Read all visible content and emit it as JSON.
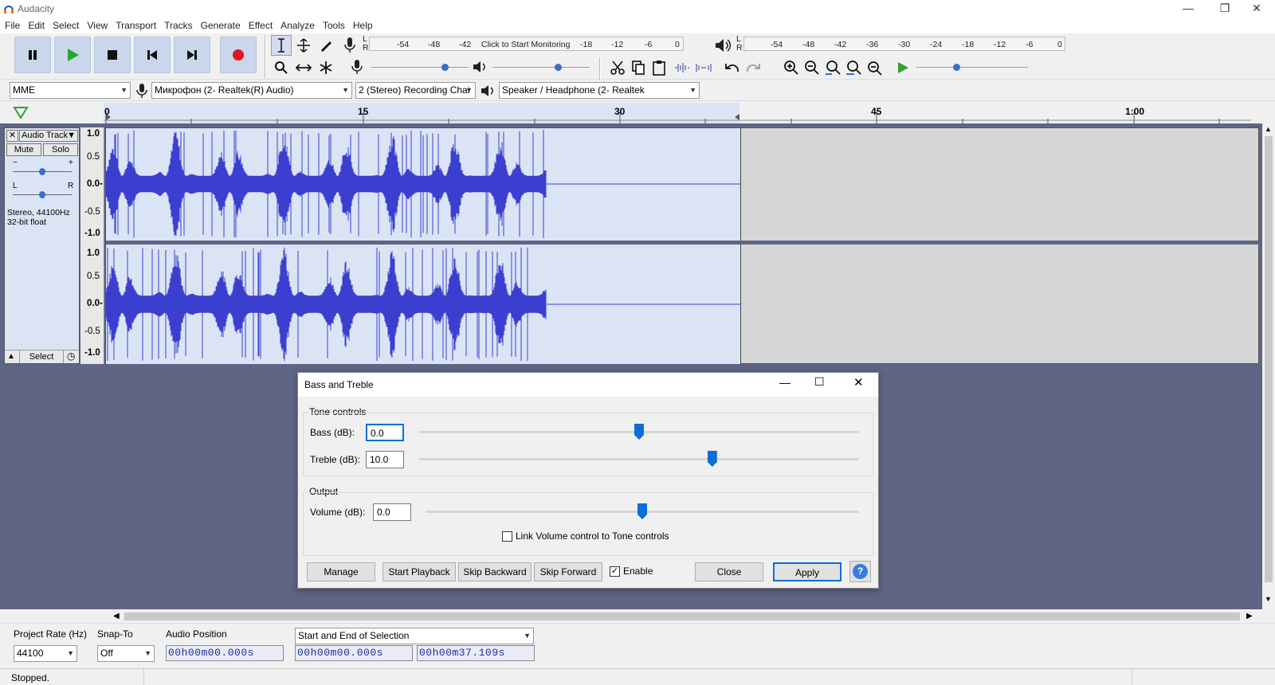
{
  "app": {
    "title": "Audacity"
  },
  "menu": [
    "File",
    "Edit",
    "Select",
    "View",
    "Transport",
    "Tracks",
    "Generate",
    "Effect",
    "Analyze",
    "Tools",
    "Help"
  ],
  "meters": {
    "record_ticks": [
      "-54",
      "-48",
      "-42",
      "-18",
      "-12",
      "-6",
      "0"
    ],
    "record_click": "Click to Start Monitoring",
    "play_ticks": [
      "-54",
      "-48",
      "-42",
      "-36",
      "-30",
      "-24",
      "-18",
      "-12",
      "-6",
      "0"
    ],
    "lr": [
      "L",
      "R"
    ]
  },
  "devices": {
    "host": "MME",
    "mic": "Микрофон (2- Realtek(R) Audio)",
    "channels": "2 (Stereo) Recording Chai",
    "speaker": "Speaker / Headphone (2- Realtek"
  },
  "timeline": {
    "ticks": [
      "0",
      "15",
      "30",
      "45",
      "1:00"
    ]
  },
  "track": {
    "name": "Audio Track",
    "mute": "Mute",
    "solo": "Solo",
    "gain_minus": "−",
    "gain_plus": "+",
    "pan_l": "L",
    "pan_r": "R",
    "info1": "Stereo, 44100Hz",
    "info2": "32-bit float",
    "select": "Select",
    "scale": [
      "1.0",
      "0.5",
      "0.0-",
      "-0.5",
      "-1.0"
    ],
    "clip_seconds": 37.109,
    "audio_seconds": 25.8
  },
  "dialog": {
    "title": "Bass and Treble",
    "tone_group": "Tone controls",
    "bass_label": "Bass (dB):",
    "bass_value": "0.0",
    "treble_label": "Treble (dB):",
    "treble_value": "10.0",
    "output_group": "Output",
    "volume_label": "Volume (dB):",
    "volume_value": "0.0",
    "link_label": "Link Volume control to Tone controls",
    "link_checked": false,
    "manage": "Manage",
    "start_playback": "Start Playback",
    "skip_backward": "Skip Backward",
    "skip_forward": "Skip Forward",
    "enable": "Enable",
    "enable_checked": true,
    "close": "Close",
    "apply": "Apply",
    "help": "?",
    "bass_level": 0.5,
    "treble_level": 0.67,
    "volume_level": 0.5
  },
  "bottom": {
    "rate_label": "Project Rate (Hz)",
    "rate_value": "44100",
    "snap_label": "Snap-To",
    "snap_value": "Off",
    "pos_label": "Audio Position",
    "pos_value": "00h00m00.000s",
    "sel_mode": "Start and End of Selection",
    "sel_start": "00h00m00.000s",
    "sel_end": "00h00m37.109s"
  },
  "status": {
    "text": "Stopped."
  },
  "colors": {
    "wave": "#3b3fd0",
    "selected_bg": "#dbe4f5",
    "record": "#e81123",
    "accent": "#0a6fd6",
    "time_text": "#1b2fa3"
  }
}
